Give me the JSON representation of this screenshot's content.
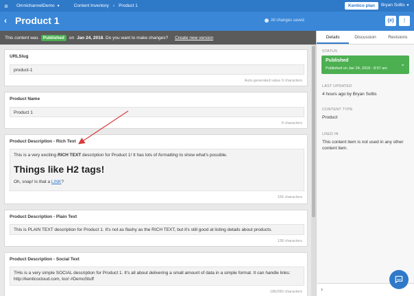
{
  "nav": {
    "project": "OmnichannelDemo",
    "section": "Content Inventory",
    "item": "Product 1",
    "plan_button": "Kentico plan",
    "user": "Bryan Soltis"
  },
  "header": {
    "title": "Product 1",
    "saved_status": "All changes saved",
    "code_button": "{#}",
    "more_button": "⋮"
  },
  "status_strip": {
    "prefix": "This content was",
    "state": "Published",
    "on_text": "on",
    "date": "Jan 24, 2018",
    "question": ". Do you want to make changes?",
    "new_version": "Create new version"
  },
  "elements": {
    "urlslug": {
      "label": "URLSlug",
      "value": "product-1",
      "hint": "Auto-generated value 9 characters"
    },
    "product_name": {
      "label": "Product Name",
      "value": "Product 1",
      "hint": "9 characters"
    },
    "rich_text": {
      "label": "Product Description - Rich Text",
      "p1_a": "This is a very exciting ",
      "p1_b": "RICH TEXT",
      "p1_c": " description for Product 1! It has lots of ",
      "p1_d": "formatting",
      "p1_e": " to show what's possible.",
      "h2": "Things like H2 tags!",
      "p2_a": "Oh, snap! Is that a ",
      "p2_link": "LINK",
      "p2_b": "?",
      "hint": "156 characters"
    },
    "plain_text": {
      "label": "Product Description - Plain Text",
      "value": "This is PLAIN TEXT description for Product 1. It's not as flashy as the RICH TEXT, but it's still good at listing details about products.",
      "hint": "138 characters"
    },
    "social_text": {
      "label": "Product Description - Social Text",
      "line1": "THis is a very simple SOCIAL description for Product 1. It's all about delivering a small amount of data in a simple format. It can handle links:",
      "line2": "http://kenticocloud.com, too! #DemoStuff",
      "hint": "186/280 characters"
    }
  },
  "panel": {
    "tabs": [
      "Details",
      "Discussion",
      "Revisions"
    ],
    "status_heading": "STATUS",
    "status_value": "Published",
    "status_sub": "Published on Jan 24, 2018 - 8:57 am",
    "last_updated_heading": "LAST UPDATED",
    "last_updated_value": "4 hours ago by Bryan Soltis",
    "content_type_heading": "CONTENT TYPE",
    "content_type_value": "Product",
    "used_in_heading": "USED IN",
    "used_in_value": "This content item is not used in any other content item."
  },
  "colors": {
    "nav_blue": "#2f79c9",
    "title_blue": "#3a87d8",
    "published_green": "#4caf50",
    "strip_gray": "#5b5b5b",
    "annotation_red": "#d93a3a"
  }
}
